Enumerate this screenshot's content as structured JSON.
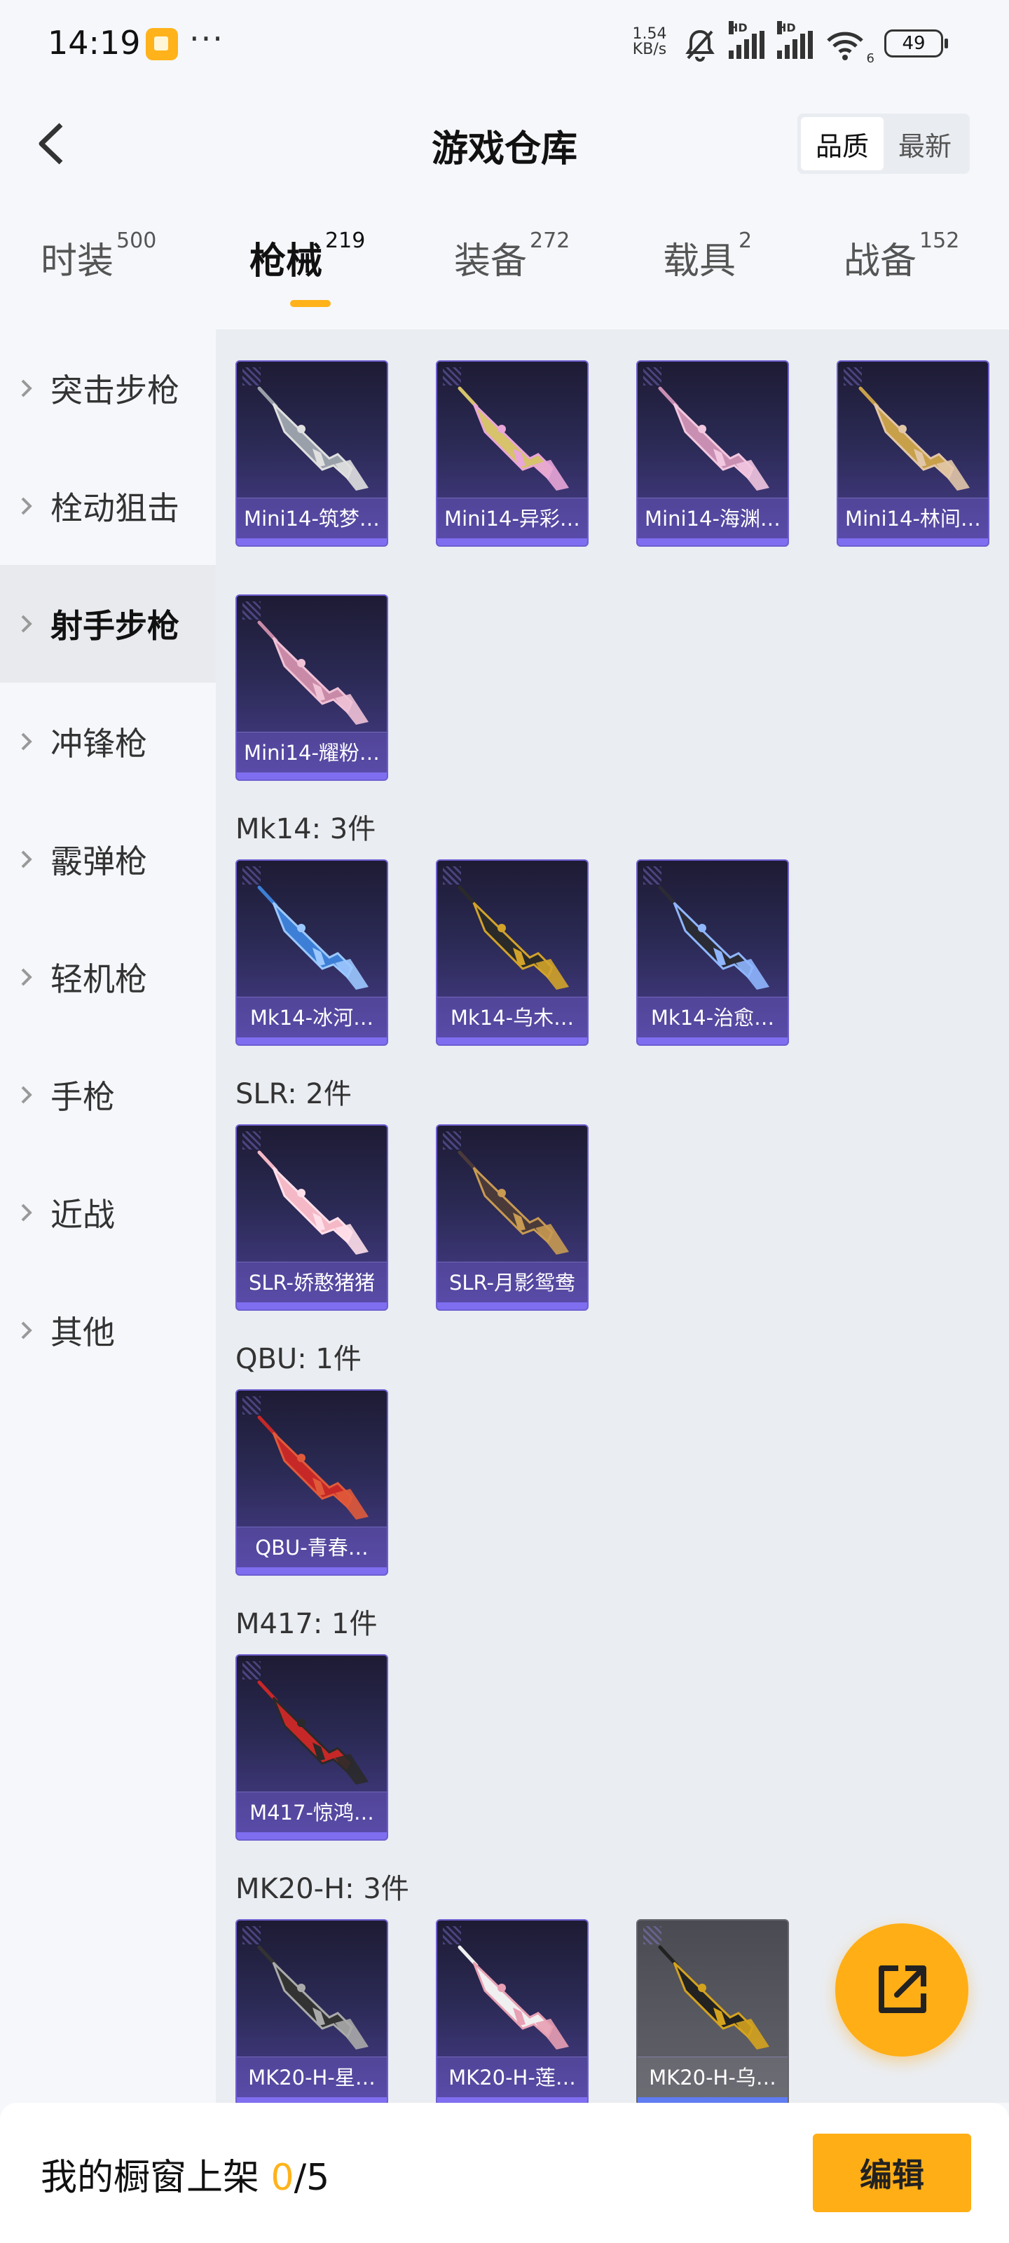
{
  "status_bar": {
    "time": "14:19",
    "net_speed": "1.54",
    "net_unit": "KB/s",
    "hd": "HD",
    "wifi_badge": "6",
    "battery": "49"
  },
  "header": {
    "title": "游戏仓库",
    "sort_options": [
      "品质",
      "最新"
    ]
  },
  "tabs": [
    {
      "label": "时装",
      "count": "500"
    },
    {
      "label": "枪械",
      "count": "219"
    },
    {
      "label": "装备",
      "count": "272"
    },
    {
      "label": "载具",
      "count": "2"
    },
    {
      "label": "战备",
      "count": "152"
    }
  ],
  "sidebar": {
    "items": [
      "突击步枪",
      "栓动狙击",
      "射手步枪",
      "冲锋枪",
      "霰弹枪",
      "轻机枪",
      "手枪",
      "近战",
      "其他"
    ]
  },
  "sections": [
    {
      "title": "",
      "items": [
        "Mini14-筑梦…",
        "Mini14-异彩…",
        "Mini14-海渊…",
        "Mini14-林间…",
        "Mini14-耀粉…"
      ]
    },
    {
      "title": "Mk14: 3件",
      "items": [
        "Mk14-冰河…",
        "Mk14-乌木…",
        "Mk14-治愈…"
      ]
    },
    {
      "title": "SLR: 2件",
      "items": [
        "SLR-娇憨猪猪",
        "SLR-月影鸳鸯"
      ]
    },
    {
      "title": "QBU: 1件",
      "items": [
        "QBU-青春…"
      ]
    },
    {
      "title": "M417: 1件",
      "items": [
        "M417-惊鸿…"
      ]
    },
    {
      "title": "MK20-H: 3件",
      "items": [
        "MK20-H-星…",
        "MK20-H-莲…",
        "MK20-H-乌…"
      ]
    }
  ],
  "bottom": {
    "showcase_label": "我的橱窗上架",
    "showcase_current": "0",
    "showcase_total": "/5",
    "edit_label": "编辑"
  },
  "colors": {
    "accent": "#ffae15",
    "card_purple": "#4a3f8f",
    "card_grey": "#5a5a62"
  },
  "icons": {
    "back": "chevron-left-icon",
    "fab": "share-external-icon"
  }
}
